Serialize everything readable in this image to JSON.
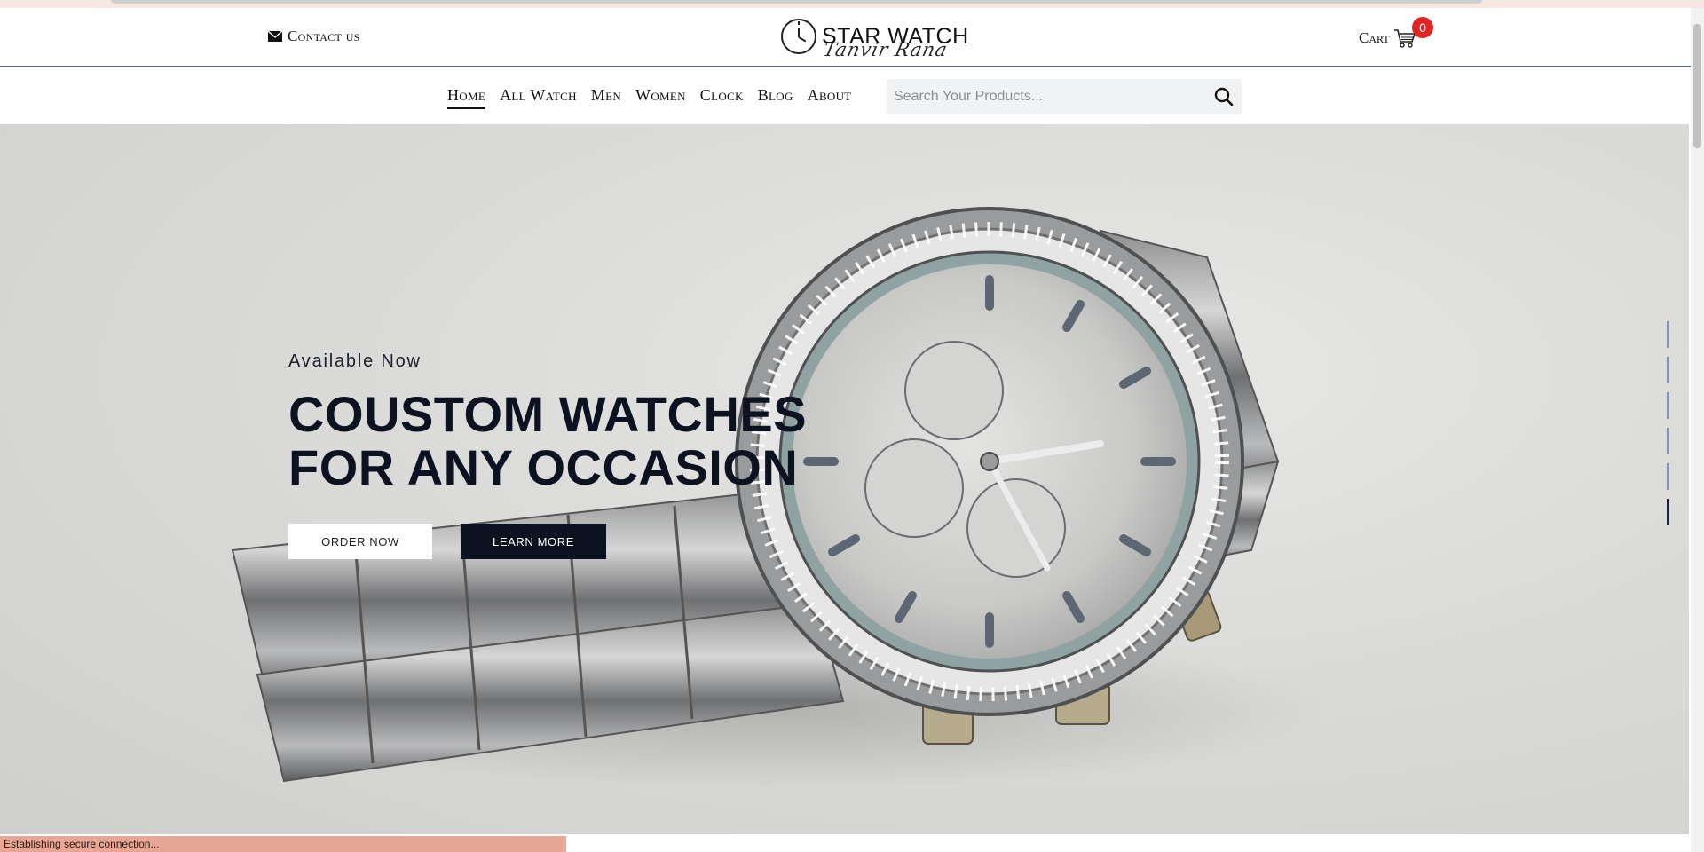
{
  "header": {
    "contact_label": "Contact us",
    "logo_brand": "STAR WATCH",
    "logo_signature": "Tanvir Rana",
    "cart_label": "Cart",
    "cart_count": "0"
  },
  "nav": {
    "items": [
      "Home",
      "All Watch",
      "Men",
      "Women",
      "Clock",
      "Blog",
      "About"
    ],
    "active": "Home"
  },
  "search": {
    "placeholder": "Search Your Products..."
  },
  "hero": {
    "eyebrow": "Available Now",
    "headline_line1": "COUSTOM WATCHES",
    "headline_line2": "FOR ANY OCCASION",
    "order_button": "ORDER NOW",
    "learn_button": "LEARN MORE",
    "slide_count": 6,
    "active_slide": 6
  },
  "status_bar": {
    "text": "Establishing secure connection..."
  },
  "colors": {
    "accent_dark": "#0c1220",
    "badge_red": "#e02424",
    "status_bg": "#e8a794"
  }
}
